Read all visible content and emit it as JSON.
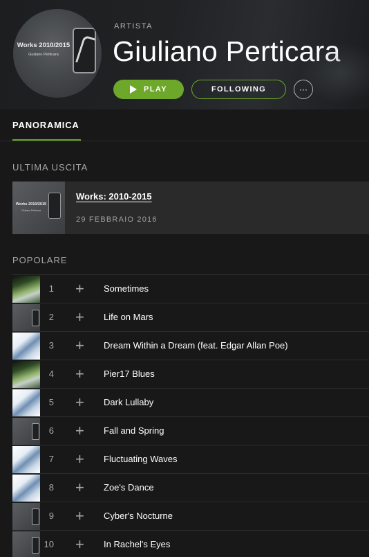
{
  "artist": {
    "type_label": "ARTISTA",
    "name": "Giuliano Perticara",
    "avatar_cover_title": "Works 2010/2015",
    "avatar_cover_artist": "Giuliano Perticara"
  },
  "actions": {
    "play_label": "PLAY",
    "following_label": "FOLLOWING",
    "more_label": "···"
  },
  "tabs": [
    {
      "label": "PANORAMICA",
      "active": true
    }
  ],
  "latest": {
    "section_title": "ULTIMA USCITA",
    "title": "Works: 2010-2015",
    "date": "29 FEBBRAIO 2016",
    "cover_title": "Works 2010/2015",
    "cover_artist": "Giuliano Perticara"
  },
  "popular": {
    "section_title": "POPOLARE",
    "tracks": [
      {
        "num": "1",
        "name": "Sometimes",
        "thumb": "green"
      },
      {
        "num": "2",
        "name": "Life on Mars",
        "thumb": "grey"
      },
      {
        "num": "3",
        "name": "Dream Within a Dream (feat. Edgar Allan Poe)",
        "thumb": "blue"
      },
      {
        "num": "4",
        "name": "Pier17 Blues",
        "thumb": "green"
      },
      {
        "num": "5",
        "name": "Dark Lullaby",
        "thumb": "blue"
      },
      {
        "num": "6",
        "name": "Fall and Spring",
        "thumb": "grey"
      },
      {
        "num": "7",
        "name": "Fluctuating Waves",
        "thumb": "blue"
      },
      {
        "num": "8",
        "name": "Zoe's Dance",
        "thumb": "blue"
      },
      {
        "num": "9",
        "name": "Cyber's Nocturne",
        "thumb": "grey"
      },
      {
        "num": "10",
        "name": "In Rachel's Eyes",
        "thumb": "grey"
      }
    ],
    "add_label": "+"
  },
  "colors": {
    "accent": "#6ea82b",
    "background": "#181818",
    "muted_text": "#a8a8a8"
  }
}
